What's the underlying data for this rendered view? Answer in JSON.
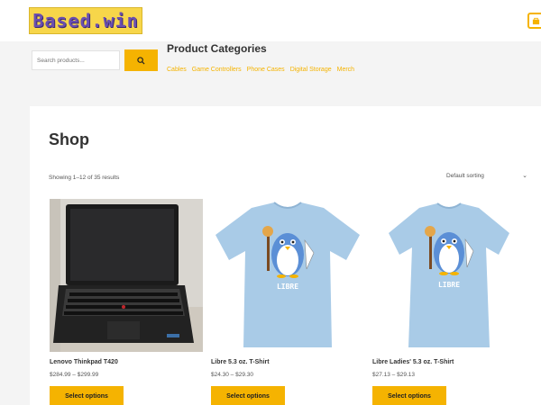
{
  "header": {
    "logo_text": "Based.win",
    "cart_icon": "cart-icon"
  },
  "search": {
    "placeholder": "Search products...",
    "button_icon": "search-icon"
  },
  "categories": {
    "title": "Product Categories",
    "items": [
      "Cables",
      "Game Controllers",
      "Phone Cases",
      "Digital Storage",
      "Merch"
    ]
  },
  "shop": {
    "title": "Shop",
    "result_count": "Showing 1–12 of 35 results",
    "sorting": "Default sorting"
  },
  "products": [
    {
      "name": "Lenovo Thinkpad T420",
      "price": "$284.99 – $299.99",
      "button": "Select options",
      "image": "laptop-photo"
    },
    {
      "name": "Libre 5.3 oz. T-Shirt",
      "price": "$24.30 – $29.30",
      "button": "Select options",
      "image": "tshirt-libre-photo"
    },
    {
      "name": "Libre Ladies' 5.3 oz. T-Shirt",
      "price": "$27.13 – $29.13",
      "button": "Select options",
      "image": "tshirt-libre-ladies-photo"
    },
    {
      "shirt_text": "LIBRE"
    }
  ],
  "colors": {
    "accent": "#f5b301",
    "shirt": "#a9cbe7",
    "logo_bg": "#f7d64a"
  }
}
